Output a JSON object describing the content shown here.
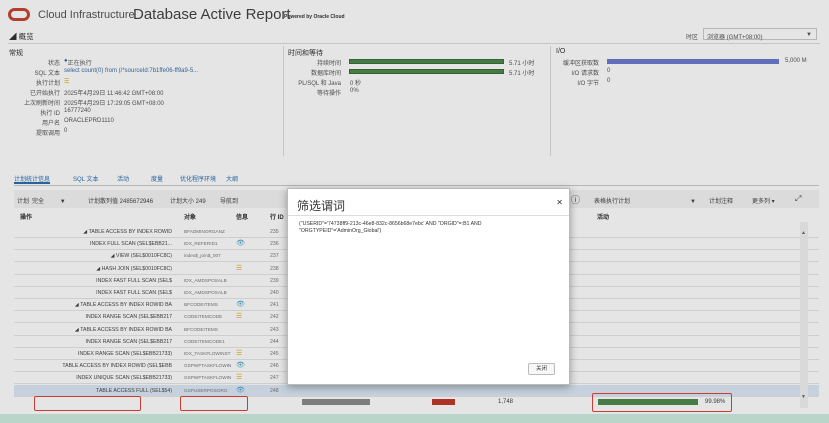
{
  "header": {
    "brand": "Cloud Infrastructure",
    "report_title": "Database Active Report",
    "powered_by": "Powered by Oracle Cloud",
    "section": "◢ 概览",
    "timezone_label": "时区",
    "timezone_value": "浏览器 (GMT+08:00)"
  },
  "summary": {
    "title": "常规",
    "rows": [
      {
        "k": "状态",
        "v": "正在执行"
      },
      {
        "k": "SQL 文本",
        "v": "select count(0) from (/*sourceId:7b1ffe06-ff9a9-5..."
      },
      {
        "k": "执行计划",
        "v": ""
      },
      {
        "k": "已开始执行",
        "v": "2025年4月29日 11:46:42 GMT+08:00"
      },
      {
        "k": "上次刷新时间",
        "v": "2025年4月29日 17:29:05 GMT+08:00"
      },
      {
        "k": "执行 ID",
        "v": "16777240"
      },
      {
        "k": "用户名",
        "v": "ORACLEPRD1110"
      },
      {
        "k": "提取调用",
        "v": "0"
      }
    ]
  },
  "time_wait": {
    "title": "时间和等待",
    "rows": [
      {
        "k": "持续时间",
        "v": "5.71 小时",
        "pct": 1.0
      },
      {
        "k": "数据库时间",
        "v": "5.71 小时",
        "pct": 1.0
      },
      {
        "k": "PL/SQL 和 Java",
        "v": "0 秒",
        "pct": 0
      },
      {
        "k": "等待操作",
        "v": "0%",
        "pct": 0
      }
    ]
  },
  "io": {
    "title": "I/O",
    "rows": [
      {
        "k": "缓冲区获取数",
        "v": "5,000 M",
        "pct": 1.0
      },
      {
        "k": "I/O 请求数",
        "v": "0",
        "pct": 0
      },
      {
        "k": "I/O 字节",
        "v": "0",
        "pct": 0
      }
    ]
  },
  "tabs": [
    "计划统计信息",
    "SQL 文本",
    "活动",
    "度量",
    "优化程序环境",
    "大纲"
  ],
  "toolbar": {
    "plan_label": "计划",
    "plan_value": "完全",
    "hash_label": "计划散列值 2485672946",
    "size_label": "计划大小 249",
    "nav_label": "导航到",
    "table_plan_label": "表格执行计划",
    "plan_note": "计划注释",
    "more_cols": "更多列"
  },
  "columns": {
    "op": "操作",
    "obj": "对象",
    "info": "信息",
    "id": "行 ID",
    "activity": "活动"
  },
  "rows": [
    {
      "op": "◢ TABLE ACCESS BY INDEX ROWID",
      "obj": "BFADMINORGANZ",
      "id": "235",
      "icon": ""
    },
    {
      "op": "INDEX FULL SCAN (SEL$EBB21...",
      "obj": "IDX_REFERID1",
      "id": "236",
      "icon": "👁"
    },
    {
      "op": "◢ VIEW (SEL$0010FC8C)",
      "obj": "index$_join$_007",
      "id": "237",
      "icon": ""
    },
    {
      "op": "◢ HASH JOIN (SEL$0010FC8C)",
      "obj": "",
      "id": "238",
      "icon": "☰"
    },
    {
      "op": "INDEX FAST FULL SCAN (SEL$",
      "obj": "IDX_AMDSPOSALB",
      "id": "239",
      "icon": ""
    },
    {
      "op": "INDEX FAST FULL SCAN (SEL$",
      "obj": "IDX_AMDSPOSALB",
      "id": "240",
      "icon": ""
    },
    {
      "op": "◢ TABLE ACCESS BY INDEX ROWID BA",
      "obj": "BFCODEITEMS",
      "id": "241",
      "icon": "👁"
    },
    {
      "op": "INDEX RANGE SCAN (SEL$EBB217",
      "obj": "CODEITEMCODE",
      "id": "242",
      "icon": "☰"
    },
    {
      "op": "◢ TABLE ACCESS BY INDEX ROWID BA",
      "obj": "BFCODEITEMS",
      "id": "243",
      "icon": ""
    },
    {
      "op": "INDEX RANGE SCAN (SEL$EBB217",
      "obj": "CODEITEMCODE1",
      "id": "244",
      "icon": ""
    },
    {
      "op": "INDEX RANGE SCAN (SEL$EBB21733)",
      "obj": "IDX_TASKFLOWINST",
      "id": "245",
      "icon": "☰"
    },
    {
      "op": "TABLE ACCESS BY INDEX ROWID (SEL$EBB",
      "obj": "GSPWFTASKFLOWIN",
      "id": "246",
      "icon": "👁"
    },
    {
      "op": "INDEX UNIQUE SCAN (SEL$EBB21733)",
      "obj": "GSPWFTASKFLOWIN",
      "id": "247",
      "icon": "☰"
    },
    {
      "op": "TABLE ACCESS FULL (SEL$54)",
      "obj": "GSPUSERPOSORG",
      "id": "248",
      "icon": "👁"
    }
  ],
  "last_row": {
    "io_value": "1,748",
    "activity_pct": "99.98%"
  },
  "modal": {
    "title": "筛选谓词",
    "body": "(\"USERID\"='74738ff9-213c-46e8-832c-8656b68e7ebc' AND \"ORGID\"=:B1 AND \"ORGTYPEID\"='AdminOrg_Global')",
    "close_button": "关闭"
  },
  "colors": {
    "oracle_red": "#c74634",
    "bar_green": "#4e8a4b",
    "bar_purple": "#6c7bd0",
    "link_blue": "#2a6fb0",
    "highlight_red": "#e0443a"
  }
}
